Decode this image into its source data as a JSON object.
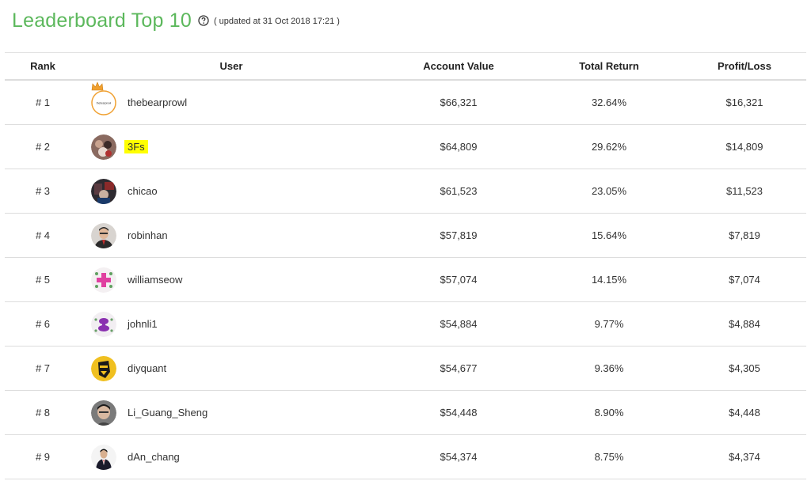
{
  "header": {
    "title": "Leaderboard Top 10",
    "updated": "( updated at 31 Oct 2018 17:21 )",
    "help_icon": "question-circle-icon"
  },
  "columns": {
    "rank": "Rank",
    "user": "User",
    "account_value": "Account Value",
    "total_return": "Total Return",
    "profit_loss": "Profit/Loss"
  },
  "colors": {
    "title": "#5cb85c",
    "highlight": "#ffff00",
    "crown": "#f0a030"
  },
  "rows": [
    {
      "rank": "# 1",
      "user": "thebearprowl",
      "account_value": "$66,321",
      "total_return": "32.64%",
      "profit_loss": "$16,321",
      "avatar_text": "thebearprowl",
      "crown": true
    },
    {
      "rank": "# 2",
      "user": "3Fs",
      "account_value": "$64,809",
      "total_return": "29.62%",
      "profit_loss": "$14,809",
      "highlighted": true
    },
    {
      "rank": "# 3",
      "user": "chicao",
      "account_value": "$61,523",
      "total_return": "23.05%",
      "profit_loss": "$11,523"
    },
    {
      "rank": "# 4",
      "user": "robinhan",
      "account_value": "$57,819",
      "total_return": "15.64%",
      "profit_loss": "$7,819"
    },
    {
      "rank": "# 5",
      "user": "williamseow",
      "account_value": "$57,074",
      "total_return": "14.15%",
      "profit_loss": "$7,074"
    },
    {
      "rank": "# 6",
      "user": "johnli1",
      "account_value": "$54,884",
      "total_return": "9.77%",
      "profit_loss": "$4,884"
    },
    {
      "rank": "# 7",
      "user": "diyquant",
      "account_value": "$54,677",
      "total_return": "9.36%",
      "profit_loss": "$4,305"
    },
    {
      "rank": "# 8",
      "user": "Li_Guang_Sheng",
      "account_value": "$54,448",
      "total_return": "8.90%",
      "profit_loss": "$4,448"
    },
    {
      "rank": "# 9",
      "user": "dAn_chang",
      "account_value": "$54,374",
      "total_return": "8.75%",
      "profit_loss": "$4,374"
    }
  ]
}
